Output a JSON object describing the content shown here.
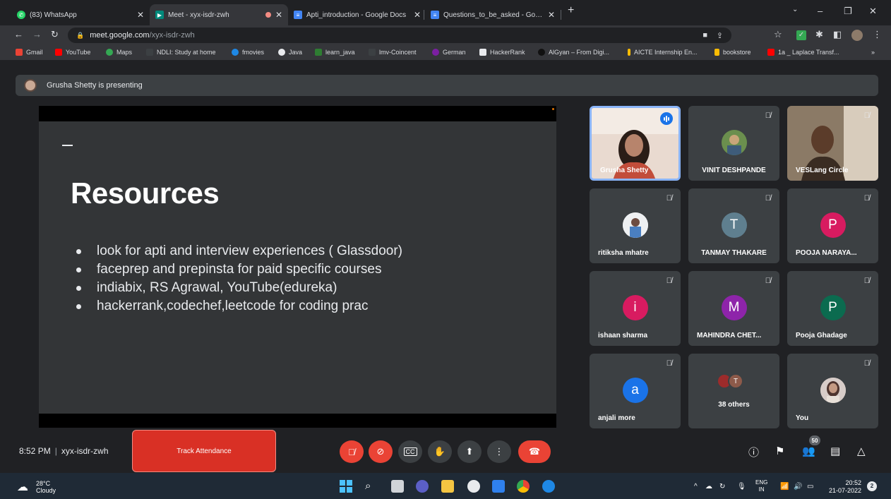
{
  "browser": {
    "tabs": [
      {
        "title": "(83) WhatsApp",
        "favicon": "whatsapp-icon",
        "color": "#25d366"
      },
      {
        "title": "Meet - xyx-isdr-zwh",
        "favicon": "meet-icon",
        "color": "#00897b"
      },
      {
        "title": "Apti_introduction - Google Docs",
        "favicon": "docs-icon",
        "color": "#4285f4"
      },
      {
        "title": "Questions_to_be_asked - Google",
        "favicon": "docs-icon",
        "color": "#4285f4"
      }
    ],
    "address": {
      "host": "meet.google.com",
      "path": "/xyx-isdr-zwh"
    },
    "bookmarks": [
      "Gmail",
      "YouTube",
      "Maps",
      "NDLI: Study at home",
      "fmovies",
      "Java",
      "learn_java",
      "lmv-Coincent",
      "German",
      "HackerRank",
      "AlGyan – From Digi...",
      "AICTE Internship En...",
      "bookstore",
      "1a _ Laplace Transf..."
    ]
  },
  "meet": {
    "presenting_text": "Grusha Shetty is presenting",
    "slide": {
      "title": "Resources",
      "bullets": [
        "look for apti and interview experiences ( Glassdoor)",
        "faceprep and prepinsta for paid specific courses",
        "indiabix, RS Agrawal, YouTube(edureka)",
        "hackerrank,codechef,leetcode for coding prac"
      ]
    },
    "participants": [
      {
        "name": "Grusha Shetty",
        "type": "video"
      },
      {
        "name": "VINIT DESHPANDE",
        "type": "photo"
      },
      {
        "name": "VESLang Circle",
        "type": "video"
      },
      {
        "name": "ritiksha mhatre",
        "type": "photo"
      },
      {
        "name": "TANMAY THAKARE",
        "initial": "T",
        "color": "#5f7f8f"
      },
      {
        "name": "POOJA NARAYA...",
        "initial": "P",
        "color": "#d81b60"
      },
      {
        "name": "ishaan sharma",
        "initial": "i",
        "color": "#d81b60"
      },
      {
        "name": "MAHINDRA CHET...",
        "initial": "M",
        "color": "#8e24aa"
      },
      {
        "name": "Pooja Ghadage",
        "initial": "P",
        "color": "#0b6b4f"
      },
      {
        "name": "anjali more",
        "initial": "a",
        "color": "#1a73e8"
      },
      {
        "name": "38 others",
        "others_initial": "T"
      },
      {
        "name": "You",
        "type": "photo"
      }
    ],
    "bottom": {
      "time": "8:52 PM",
      "meeting_code": "xyx-isdr-zwh",
      "track_attendance": "Track Attendance",
      "people_count": "50"
    }
  },
  "taskbar": {
    "weather_temp": "28°C",
    "weather_desc": "Cloudy",
    "lang_top": "ENG",
    "lang_bottom": "IN",
    "time": "20:52",
    "date": "21-07-2022",
    "notifications": "2"
  }
}
